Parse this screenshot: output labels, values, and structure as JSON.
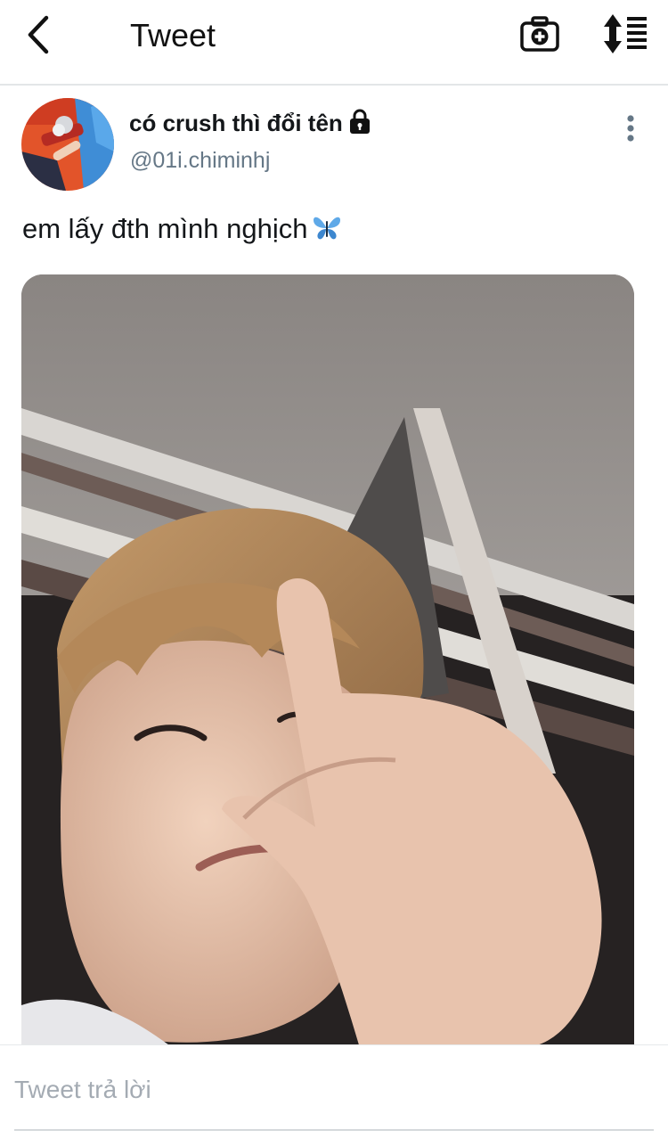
{
  "header": {
    "title": "Tweet",
    "back_icon": "chevron-left-icon",
    "camera_icon": "camera-plus-icon",
    "sort_icon": "sort-list-icon"
  },
  "tweet": {
    "author_name": "có crush thì đổi tên",
    "author_handle": "@01i.chiminhj",
    "protected_icon": "lock-icon",
    "more_icon": "more-vertical-icon",
    "text": "em lấy đth mình nghịch",
    "emoji_icon": "butterfly-icon",
    "media_description_icon": "photo-icon"
  },
  "reply": {
    "placeholder": "Tweet trả lời"
  },
  "colors": {
    "primary_text": "#14171a",
    "secondary_text": "#657786",
    "placeholder_text": "#a4abb3",
    "divider": "#e3e6e8"
  }
}
